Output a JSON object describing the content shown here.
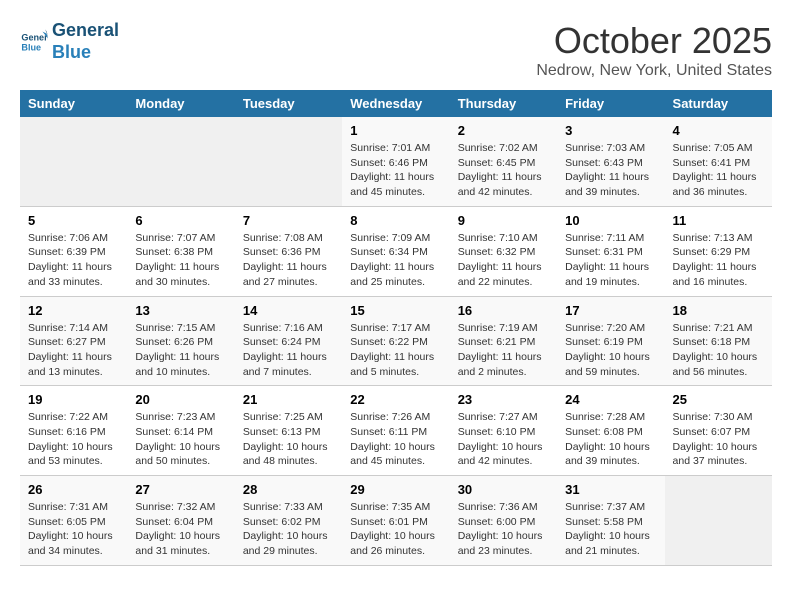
{
  "header": {
    "logo_line1": "General",
    "logo_line2": "Blue",
    "month": "October 2025",
    "location": "Nedrow, New York, United States"
  },
  "weekdays": [
    "Sunday",
    "Monday",
    "Tuesday",
    "Wednesday",
    "Thursday",
    "Friday",
    "Saturday"
  ],
  "weeks": [
    [
      {
        "day": "",
        "info": ""
      },
      {
        "day": "",
        "info": ""
      },
      {
        "day": "",
        "info": ""
      },
      {
        "day": "1",
        "info": "Sunrise: 7:01 AM\nSunset: 6:46 PM\nDaylight: 11 hours and 45 minutes."
      },
      {
        "day": "2",
        "info": "Sunrise: 7:02 AM\nSunset: 6:45 PM\nDaylight: 11 hours and 42 minutes."
      },
      {
        "day": "3",
        "info": "Sunrise: 7:03 AM\nSunset: 6:43 PM\nDaylight: 11 hours and 39 minutes."
      },
      {
        "day": "4",
        "info": "Sunrise: 7:05 AM\nSunset: 6:41 PM\nDaylight: 11 hours and 36 minutes."
      }
    ],
    [
      {
        "day": "5",
        "info": "Sunrise: 7:06 AM\nSunset: 6:39 PM\nDaylight: 11 hours and 33 minutes."
      },
      {
        "day": "6",
        "info": "Sunrise: 7:07 AM\nSunset: 6:38 PM\nDaylight: 11 hours and 30 minutes."
      },
      {
        "day": "7",
        "info": "Sunrise: 7:08 AM\nSunset: 6:36 PM\nDaylight: 11 hours and 27 minutes."
      },
      {
        "day": "8",
        "info": "Sunrise: 7:09 AM\nSunset: 6:34 PM\nDaylight: 11 hours and 25 minutes."
      },
      {
        "day": "9",
        "info": "Sunrise: 7:10 AM\nSunset: 6:32 PM\nDaylight: 11 hours and 22 minutes."
      },
      {
        "day": "10",
        "info": "Sunrise: 7:11 AM\nSunset: 6:31 PM\nDaylight: 11 hours and 19 minutes."
      },
      {
        "day": "11",
        "info": "Sunrise: 7:13 AM\nSunset: 6:29 PM\nDaylight: 11 hours and 16 minutes."
      }
    ],
    [
      {
        "day": "12",
        "info": "Sunrise: 7:14 AM\nSunset: 6:27 PM\nDaylight: 11 hours and 13 minutes."
      },
      {
        "day": "13",
        "info": "Sunrise: 7:15 AM\nSunset: 6:26 PM\nDaylight: 11 hours and 10 minutes."
      },
      {
        "day": "14",
        "info": "Sunrise: 7:16 AM\nSunset: 6:24 PM\nDaylight: 11 hours and 7 minutes."
      },
      {
        "day": "15",
        "info": "Sunrise: 7:17 AM\nSunset: 6:22 PM\nDaylight: 11 hours and 5 minutes."
      },
      {
        "day": "16",
        "info": "Sunrise: 7:19 AM\nSunset: 6:21 PM\nDaylight: 11 hours and 2 minutes."
      },
      {
        "day": "17",
        "info": "Sunrise: 7:20 AM\nSunset: 6:19 PM\nDaylight: 10 hours and 59 minutes."
      },
      {
        "day": "18",
        "info": "Sunrise: 7:21 AM\nSunset: 6:18 PM\nDaylight: 10 hours and 56 minutes."
      }
    ],
    [
      {
        "day": "19",
        "info": "Sunrise: 7:22 AM\nSunset: 6:16 PM\nDaylight: 10 hours and 53 minutes."
      },
      {
        "day": "20",
        "info": "Sunrise: 7:23 AM\nSunset: 6:14 PM\nDaylight: 10 hours and 50 minutes."
      },
      {
        "day": "21",
        "info": "Sunrise: 7:25 AM\nSunset: 6:13 PM\nDaylight: 10 hours and 48 minutes."
      },
      {
        "day": "22",
        "info": "Sunrise: 7:26 AM\nSunset: 6:11 PM\nDaylight: 10 hours and 45 minutes."
      },
      {
        "day": "23",
        "info": "Sunrise: 7:27 AM\nSunset: 6:10 PM\nDaylight: 10 hours and 42 minutes."
      },
      {
        "day": "24",
        "info": "Sunrise: 7:28 AM\nSunset: 6:08 PM\nDaylight: 10 hours and 39 minutes."
      },
      {
        "day": "25",
        "info": "Sunrise: 7:30 AM\nSunset: 6:07 PM\nDaylight: 10 hours and 37 minutes."
      }
    ],
    [
      {
        "day": "26",
        "info": "Sunrise: 7:31 AM\nSunset: 6:05 PM\nDaylight: 10 hours and 34 minutes."
      },
      {
        "day": "27",
        "info": "Sunrise: 7:32 AM\nSunset: 6:04 PM\nDaylight: 10 hours and 31 minutes."
      },
      {
        "day": "28",
        "info": "Sunrise: 7:33 AM\nSunset: 6:02 PM\nDaylight: 10 hours and 29 minutes."
      },
      {
        "day": "29",
        "info": "Sunrise: 7:35 AM\nSunset: 6:01 PM\nDaylight: 10 hours and 26 minutes."
      },
      {
        "day": "30",
        "info": "Sunrise: 7:36 AM\nSunset: 6:00 PM\nDaylight: 10 hours and 23 minutes."
      },
      {
        "day": "31",
        "info": "Sunrise: 7:37 AM\nSunset: 5:58 PM\nDaylight: 10 hours and 21 minutes."
      },
      {
        "day": "",
        "info": ""
      }
    ]
  ]
}
